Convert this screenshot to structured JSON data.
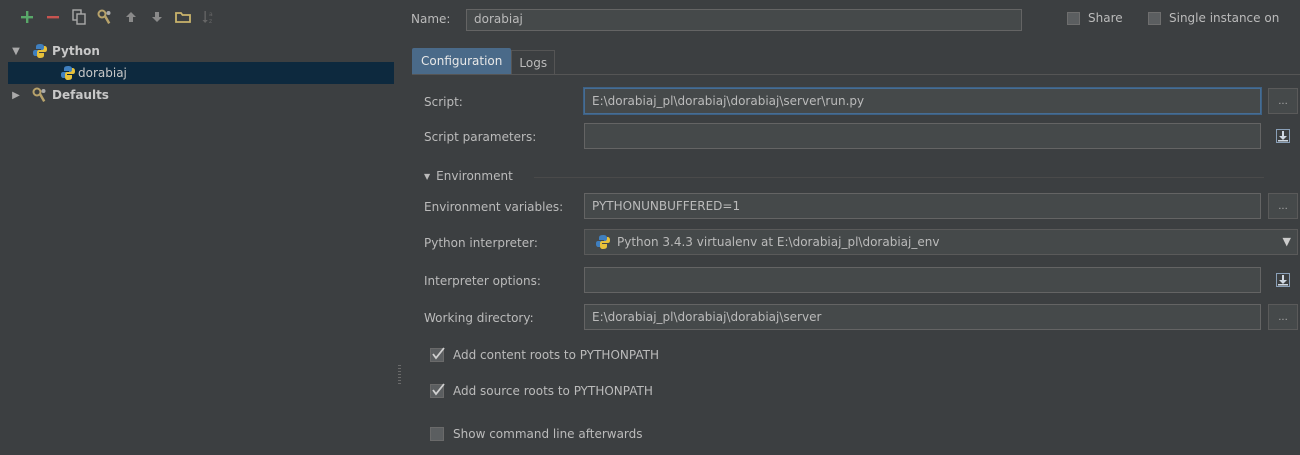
{
  "toolbar": {
    "icons": [
      "add-icon",
      "remove-icon",
      "copy-icon",
      "edit-defaults-icon",
      "move-up-icon",
      "move-down-icon",
      "folder-icon",
      "sort-icon"
    ]
  },
  "tree": {
    "python_label": "Python",
    "config_label": "dorabiaj",
    "defaults_label": "Defaults"
  },
  "header": {
    "name_label": "Name:",
    "name_value": "dorabiaj",
    "share_label": "Share",
    "single_instance_label": "Single instance on"
  },
  "tabs": {
    "configuration": "Configuration",
    "logs": "Logs"
  },
  "form": {
    "script_label": "Script:",
    "script_value": "E:\\dorabiaj_pl\\dorabiaj\\dorabiaj\\server\\run.py",
    "script_params_label": "Script parameters:",
    "script_params_value": "",
    "environment_section": "Environment",
    "env_vars_label": "Environment variables:",
    "env_vars_value": "PYTHONUNBUFFERED=1",
    "interpreter_label": "Python interpreter:",
    "interpreter_value": "Python 3.4.3 virtualenv at E:\\dorabiaj_pl\\dorabiaj_env",
    "interp_options_label": "Interpreter options:",
    "interp_options_value": "",
    "working_dir_label": "Working directory:",
    "working_dir_value": "E:\\dorabiaj_pl\\dorabiaj\\dorabiaj\\server",
    "dots": "...",
    "add_content_roots": "Add content roots to PYTHONPATH",
    "add_source_roots": "Add source roots to PYTHONPATH",
    "show_cmd": "Show command line afterwards",
    "add_content_checked": true,
    "add_source_checked": true,
    "show_cmd_checked": false
  },
  "colors": {
    "bg": "#3c3f41",
    "selection": "#0d293e",
    "tab_active": "#4a6a89",
    "add_green": "#59a869",
    "remove_red": "#c75450"
  }
}
